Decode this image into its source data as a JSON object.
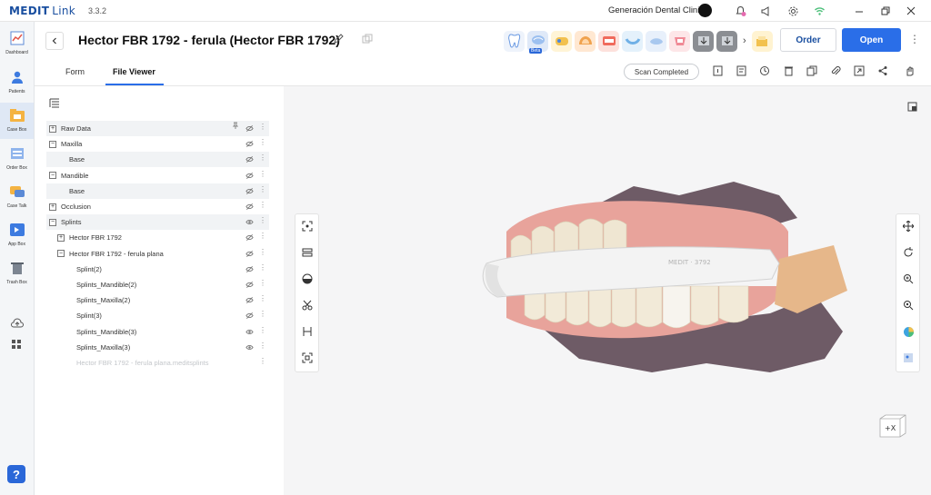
{
  "app": {
    "brand": "MEDIT",
    "brand_suffix": "Link",
    "version": "3.3.2",
    "clinic": "Generación Dental Clinic"
  },
  "leftnav": {
    "items": [
      {
        "label": "Dashboard",
        "icon": "dashboard-chart-icon"
      },
      {
        "label": "Patients",
        "icon": "patient-icon"
      },
      {
        "label": "Case Box",
        "icon": "case-box-icon",
        "active": true
      },
      {
        "label": "Order Box",
        "icon": "order-box-icon"
      },
      {
        "label": "Case Talk",
        "icon": "case-talk-icon"
      },
      {
        "label": "App Box",
        "icon": "app-box-icon"
      },
      {
        "label": "Trash Box",
        "icon": "trash-box-icon"
      }
    ],
    "help": "?"
  },
  "header": {
    "title": "Hector FBR 1792 - ferula (Hector FBR 1792)",
    "beta_label": "Beta",
    "order_label": "Order",
    "open_label": "Open"
  },
  "tabs": {
    "form": "Form",
    "file_viewer": "File Viewer",
    "scan_completed": "Scan Completed"
  },
  "tree": {
    "rows": [
      {
        "label": "Raw Data",
        "indent": 0,
        "expander": "+",
        "shade": true,
        "eye": "hidden",
        "pin": true
      },
      {
        "label": "Maxilla",
        "indent": 0,
        "expander": "−",
        "shade": false,
        "eye": "hidden"
      },
      {
        "label": "Base",
        "indent": 1,
        "expander": "",
        "shade": true,
        "eye": "hidden"
      },
      {
        "label": "Mandible",
        "indent": 0,
        "expander": "−",
        "shade": false,
        "eye": "hidden"
      },
      {
        "label": "Base",
        "indent": 1,
        "expander": "",
        "shade": true,
        "eye": "hidden"
      },
      {
        "label": "Occlusion",
        "indent": 0,
        "expander": "+",
        "shade": false,
        "eye": "hidden"
      },
      {
        "label": "Splints",
        "indent": 0,
        "expander": "−",
        "shade": true,
        "eye": "visible"
      },
      {
        "label": "Hector FBR 1792",
        "indent": 1,
        "expander": "+",
        "shade": false,
        "eye": "hidden"
      },
      {
        "label": "Hector FBR 1792 - ferula plana",
        "indent": 1,
        "expander": "−",
        "shade": false,
        "eye": "hidden"
      },
      {
        "label": "Splint(2)",
        "indent": 2,
        "expander": "",
        "shade": false,
        "eye": "hidden"
      },
      {
        "label": "Splints_Mandible(2)",
        "indent": 2,
        "expander": "",
        "shade": false,
        "eye": "hidden"
      },
      {
        "label": "Splints_Maxilla(2)",
        "indent": 2,
        "expander": "",
        "shade": false,
        "eye": "hidden"
      },
      {
        "label": "Splint(3)",
        "indent": 2,
        "expander": "",
        "shade": false,
        "eye": "hidden"
      },
      {
        "label": "Splints_Mandible(3)",
        "indent": 2,
        "expander": "",
        "shade": false,
        "eye": "visible"
      },
      {
        "label": "Splints_Maxilla(3)",
        "indent": 2,
        "expander": "",
        "shade": false,
        "eye": "visible"
      },
      {
        "label": "Hector FBR 1792 - ferula plana.meditsplints",
        "indent": 2,
        "expander": "",
        "shade": false,
        "eye": "none",
        "dim": true
      }
    ]
  },
  "viewer": {
    "axis_label": "+X",
    "splint_engraving": "MEDIT · 3792"
  },
  "colors": {
    "accent": "#2a6ee8",
    "brand": "#1a4fa0",
    "gum": "#e8a39b",
    "tooth": "#efe6d2",
    "splint": "#f3f3f3",
    "base": "#6f5d66"
  }
}
